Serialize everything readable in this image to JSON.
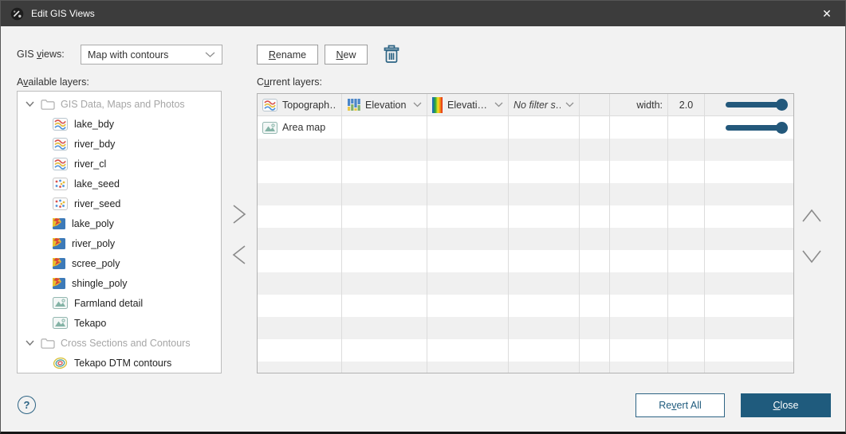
{
  "window": {
    "title": "Edit GIS Views",
    "close_glyph": "✕"
  },
  "colors": {
    "accent_blue": "#1f5b7d",
    "titlebar": "#3c3c3c",
    "slider": "#23587b"
  },
  "gis_views": {
    "label_pre": "GIS ",
    "label_key": "v",
    "label_post": "iews:",
    "selected": "Map with contours"
  },
  "toolbar": {
    "rename_pre": "",
    "rename_key": "R",
    "rename_post": "ename",
    "new_pre": "",
    "new_key": "N",
    "new_post": "ew"
  },
  "available_layers": {
    "label_pre": "A",
    "label_key": "v",
    "label_post": "ailable layers:",
    "items": [
      {
        "folder": true,
        "icon": "folder",
        "label": "GIS Data, Maps and Photos"
      },
      {
        "folder": false,
        "icon": "topo",
        "label": "lake_bdy"
      },
      {
        "folder": false,
        "icon": "topo",
        "label": "river_bdy"
      },
      {
        "folder": false,
        "icon": "topo",
        "label": "river_cl"
      },
      {
        "folder": false,
        "icon": "seed",
        "label": "lake_seed"
      },
      {
        "folder": false,
        "icon": "seed",
        "label": "river_seed"
      },
      {
        "folder": false,
        "icon": "poly",
        "label": "lake_poly"
      },
      {
        "folder": false,
        "icon": "poly",
        "label": "river_poly"
      },
      {
        "folder": false,
        "icon": "poly",
        "label": "scree_poly"
      },
      {
        "folder": false,
        "icon": "poly",
        "label": "shingle_poly"
      },
      {
        "folder": false,
        "icon": "image",
        "label": "Farmland detail"
      },
      {
        "folder": false,
        "icon": "image",
        "label": "Tekapo"
      },
      {
        "folder": true,
        "icon": "folder",
        "label": "Cross Sections and Contours"
      },
      {
        "folder": false,
        "icon": "contours",
        "label": "Tekapo DTM contours"
      }
    ]
  },
  "current_layers": {
    "label_pre": "C",
    "label_key": "u",
    "label_post": "rrent layers:",
    "rows": [
      {
        "cells": [
          {
            "icon": "topo",
            "text": "Topograph…"
          },
          {
            "icon": "columns",
            "text": "Elevation",
            "dropdown": true
          },
          {
            "icon": "gradient",
            "text": "Elevati…",
            "dropdown": true
          },
          {
            "text": "No filter s…",
            "italic": true,
            "dropdown": true
          },
          {},
          {
            "text": "width:",
            "align": "right"
          },
          {
            "text": "2.0",
            "align": "center"
          },
          {
            "slider": 100
          }
        ]
      },
      {
        "cells": [
          {
            "icon": "image",
            "text": "Area map"
          },
          {},
          {},
          {},
          {},
          {},
          {},
          {
            "slider": 100
          }
        ]
      }
    ],
    "empty_rows": 11
  },
  "footer": {
    "help_glyph": "?",
    "revert_pre": "Re",
    "revert_key": "v",
    "revert_post": "ert All",
    "close_pre": "",
    "close_key": "C",
    "close_post": "lose"
  }
}
